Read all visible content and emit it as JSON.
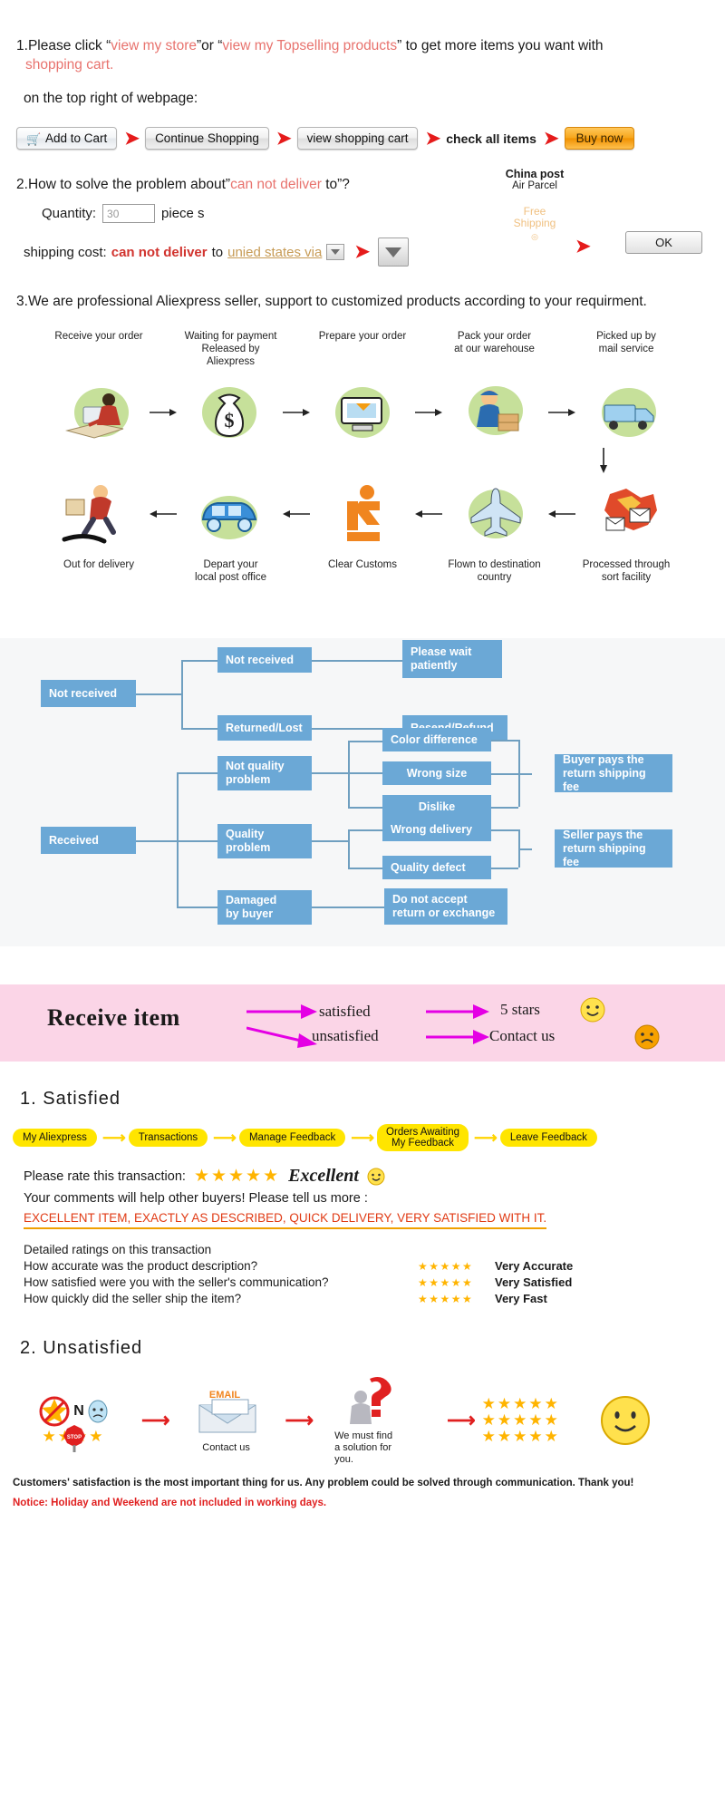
{
  "section1": {
    "number": "1.",
    "text_a": "Please click “",
    "link1": "view my store",
    "text_b": "”or “",
    "link2": "view my Topselling products",
    "text_c": "” to get more items you want with",
    "line2": "shopping cart.",
    "sub": "on the top right of webpage:",
    "buttons": [
      {
        "label": "Add to Cart",
        "icon": "shopping-cart-icon",
        "kind": "cart"
      },
      {
        "label": "Continue Shopping",
        "kind": "grey"
      },
      {
        "label": "view shopping cart",
        "kind": "grey"
      },
      {
        "label": "check all items",
        "kind": "plain"
      },
      {
        "label": "Buy now",
        "kind": "orange"
      }
    ]
  },
  "section2": {
    "number": "2.",
    "q_a": "How to solve the problem about”",
    "q_red": "can not deliver",
    "q_b": " to”?",
    "quantity_label": "Quantity:",
    "quantity_value": "30",
    "quantity_unit": "piece s",
    "shipping_label": "shipping cost:",
    "shipping_red": "can not deliver",
    "shipping_to": " to ",
    "destination": "unied states via",
    "china_post_line1": "China post",
    "china_post_line2": "Air Parcel",
    "free_shipping": "Free\nShipping",
    "ok_label": "OK"
  },
  "section3": {
    "number": "3.",
    "text": "We are professional Aliexpress seller, support to customized products according to your requirment."
  },
  "shipping_flow": {
    "top_row": [
      {
        "label": "Receive your order",
        "icon": "person-at-computer-icon"
      },
      {
        "label": "Waiting for payment\nReleased by Aliexpress",
        "icon": "money-bag-icon"
      },
      {
        "label": "Prepare your order",
        "icon": "monitor-box-icon"
      },
      {
        "label": "Pack your order\nat our warehouse",
        "icon": "worker-packing-icon"
      },
      {
        "label": "Picked up by\nmail service",
        "icon": "mail-truck-icon"
      }
    ],
    "bottom_row": [
      {
        "label": "Out for delivery",
        "icon": "running-courier-icon"
      },
      {
        "label": "Depart your\nlocal post office",
        "icon": "delivery-van-icon"
      },
      {
        "label": "Clear Customs",
        "icon": "customs-officer-icon"
      },
      {
        "label": "Flown to destination\ncountry",
        "icon": "airplane-icon"
      },
      {
        "label": "Processed through\nsort facility",
        "icon": "sorting-mail-icon"
      }
    ]
  },
  "blue_chart": {
    "root_not_received": "Not received",
    "nr_child1": "Not received",
    "nr_child2": "Returned/Lost",
    "nr_result1": "Please wait\npatiently",
    "nr_result2": "Resend/Refund",
    "root_received": "Received",
    "rv_child1": "Not quality\nproblem",
    "rv_child2": "Quality\nproblem",
    "rv_child3": "Damaged\nby buyer",
    "nq_1": "Color difference",
    "nq_2": "Wrong size",
    "nq_3": "Dislike",
    "qp_1": "Wrong delivery",
    "qp_2": "Quality defect",
    "res_buyer": "Buyer pays the\nreturn shipping fee",
    "res_seller": "Seller pays the\nreturn shipping fee",
    "res_damaged": "Do not accept\nreturn or exchange"
  },
  "pink_band": {
    "title": "Receive item",
    "satisfied": "satisfied",
    "unsatisfied": "unsatisfied",
    "five_stars": "5 stars",
    "contact_us": "Contact us",
    "smiley_happy": "happy-face-icon",
    "smiley_sad": "sad-face-icon"
  },
  "satisfied": {
    "heading": "1. Satisfied",
    "chain": [
      "My Aliexpress",
      "Transactions",
      "Manage Feedback",
      "Orders Awaiting\nMy Feedback",
      "Leave Feedback"
    ],
    "rate_label": "Please rate this transaction:",
    "stars": "★★★★★",
    "excellent": "Excellent",
    "comments_prompt": "Your comments will help other buyers! Please tell us more :",
    "comment_text": "EXCELLENT ITEM, EXACTLY AS DESCRIBED, QUICK DELIVERY, VERY SATISFIED WITH IT.",
    "detailed_heading": "Detailed ratings on this transaction",
    "ratings": [
      {
        "question": "How accurate was the product description?",
        "stars": "★★★★★",
        "value": "Very Accurate"
      },
      {
        "question": "How satisfied were you with the seller's communication?",
        "stars": "★★★★★",
        "value": "Very Satisfied"
      },
      {
        "question": "How quickly did the seller ship the item?",
        "stars": "★★★★★",
        "value": "Very Fast"
      }
    ]
  },
  "unsatisfied": {
    "heading": "2. Unsatisfied",
    "no_letter": "N",
    "stop_sign": "STOP",
    "email_label": "EMAIL",
    "contact_caption": "Contact us",
    "solution_caption": "We must find\na solution for\nyou.",
    "footnote": "Customers' satisfaction is the most important thing for us. Any problem could be solved through communication. Thank you!",
    "notice": "Notice: Holiday and Weekend are not included in working days."
  },
  "colors": {
    "red": "#d1332e",
    "link_red": "#e8736e",
    "orange_btn": "#f7a519",
    "blue_box": "#6ba8d6",
    "pink_band": "#fbd5e7",
    "yellow_pill": "#ffe500",
    "star_gold": "#ffb400",
    "magenta_arrow": "#e400e4",
    "green_blob": "#c6e09a"
  }
}
